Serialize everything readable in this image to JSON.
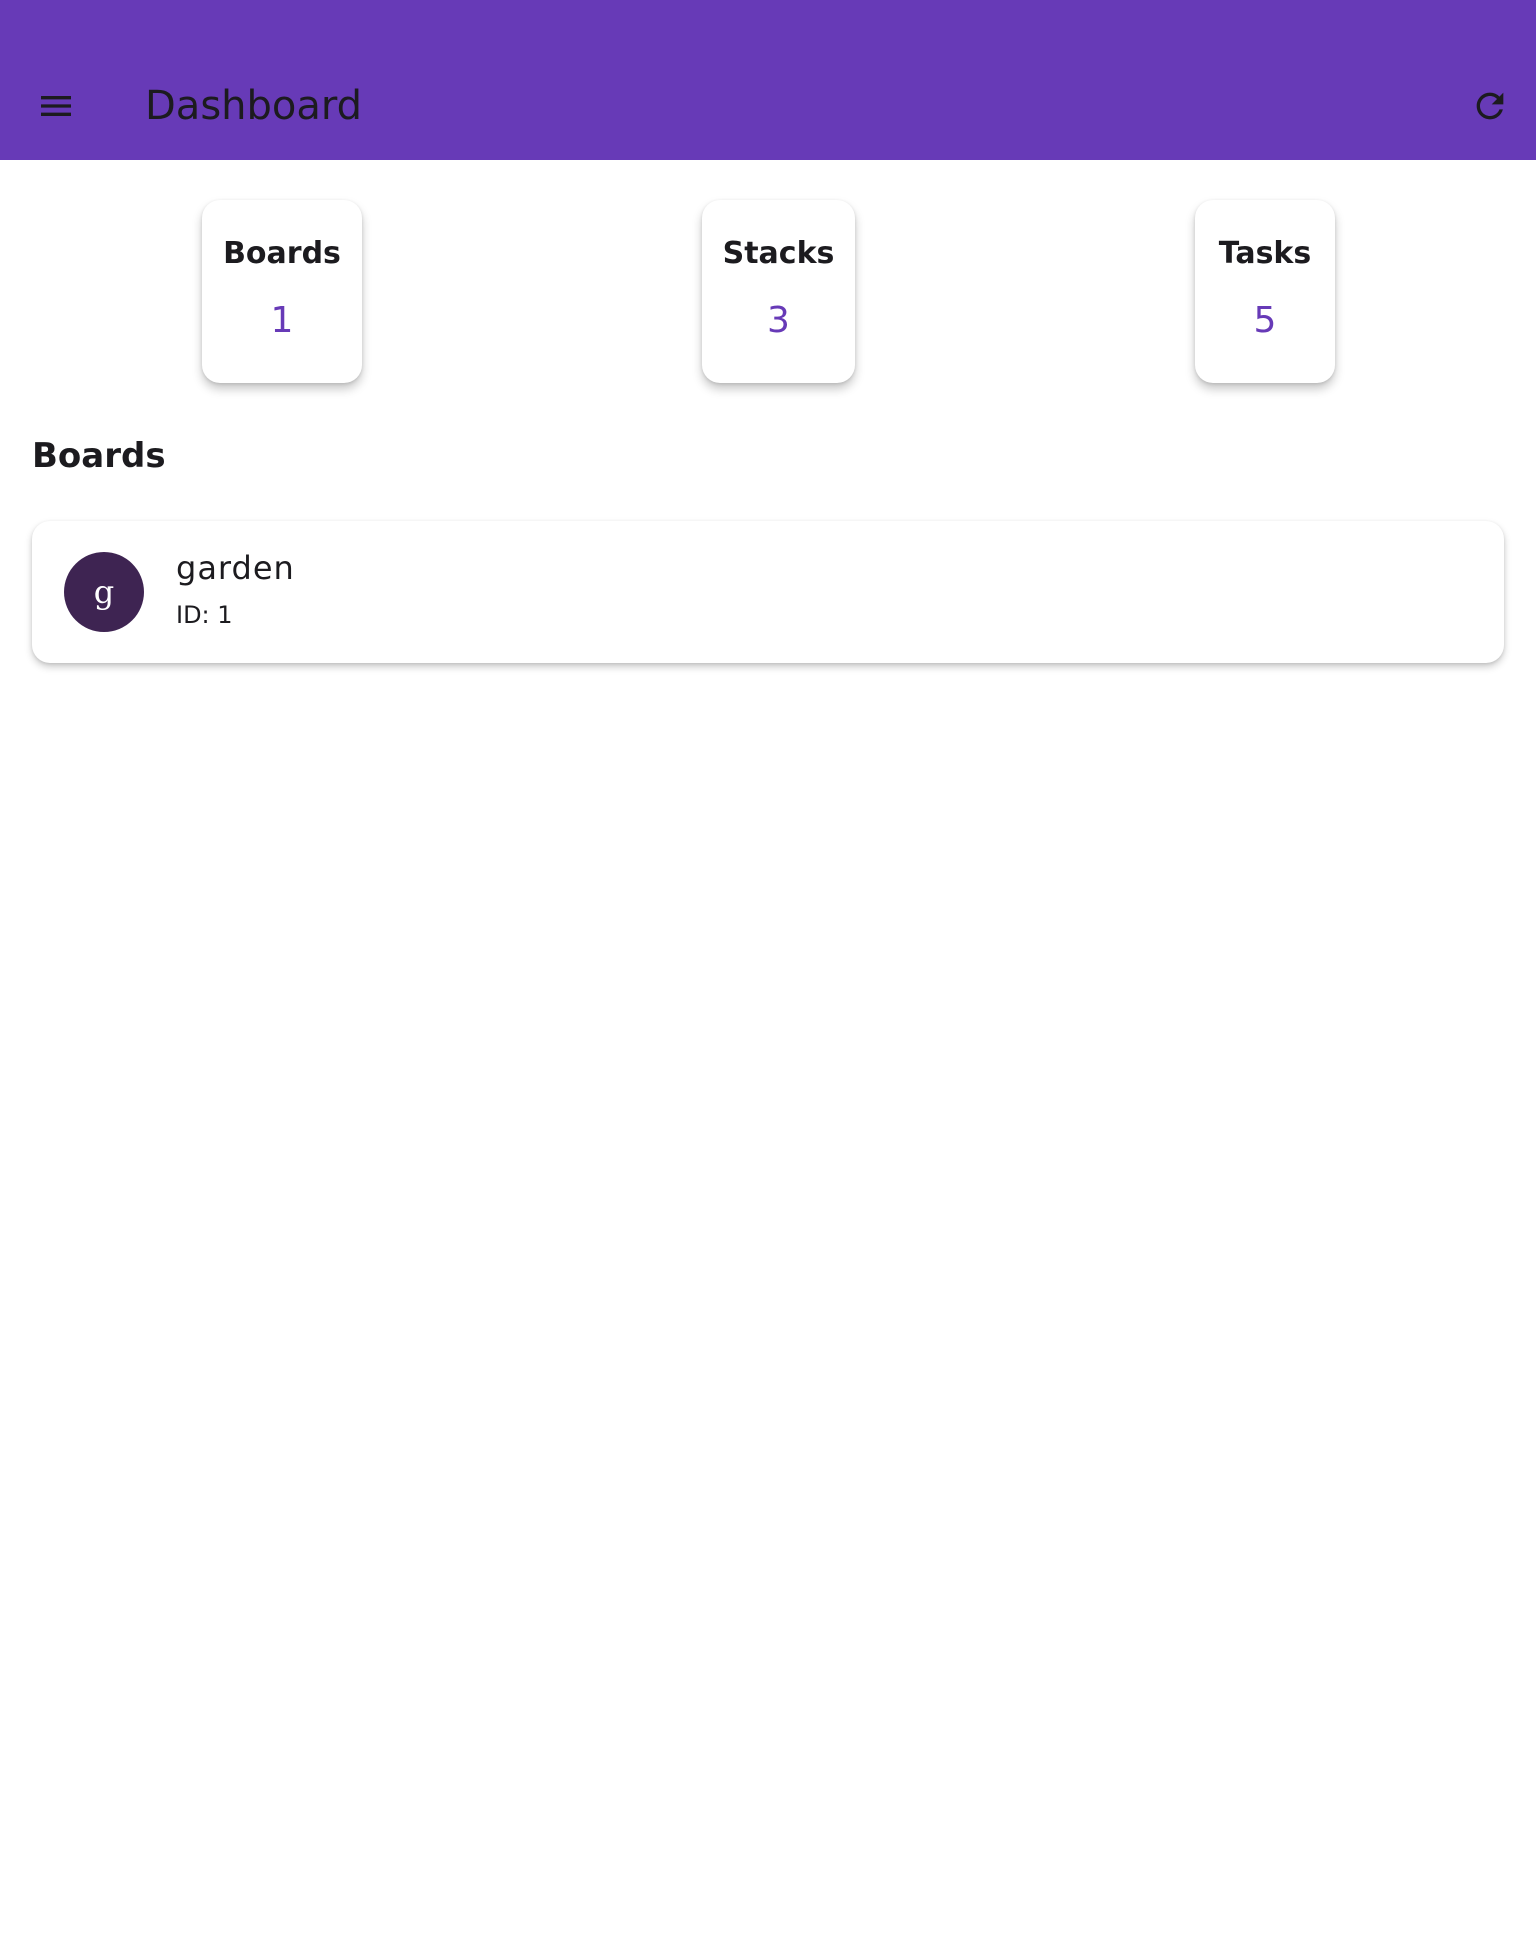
{
  "app_bar": {
    "title": "Dashboard",
    "background_color": "#673ab7",
    "menu_icon": "menu-icon",
    "refresh_icon": "refresh-icon"
  },
  "stats": [
    {
      "label": "Boards",
      "value": "1"
    },
    {
      "label": "Stacks",
      "value": "3"
    },
    {
      "label": "Tasks",
      "value": "5"
    }
  ],
  "stat_value_color": "#673ab7",
  "boards_section": {
    "title": "Boards",
    "items": [
      {
        "avatar_letter": "g",
        "avatar_color": "#3e2452",
        "name": "garden",
        "id_text": "ID: 1"
      }
    ]
  }
}
